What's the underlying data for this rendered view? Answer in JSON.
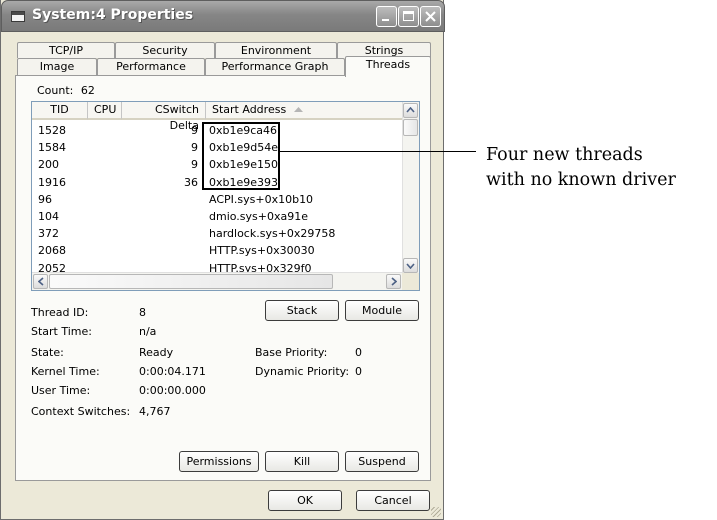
{
  "window": {
    "title": "System:4 Properties",
    "icon": "window-icon",
    "controls": [
      "minimize-icon",
      "maximize-icon",
      "close-icon"
    ]
  },
  "tabs": {
    "row1": [
      "TCP/IP",
      "Security",
      "Environment",
      "Strings"
    ],
    "row2": [
      "Image",
      "Performance",
      "Performance Graph",
      "Threads"
    ],
    "active": "Threads"
  },
  "threads": {
    "count_label": "Count:",
    "count_value": "62",
    "columns": [
      "TID",
      "CPU",
      "CSwitch Delta",
      "Start Address"
    ],
    "sort_icon": "sort-ascending-icon",
    "rows": [
      {
        "tid": "1528",
        "cpu": "",
        "cswitch": "9",
        "address": "0xb1e9ca46"
      },
      {
        "tid": "1584",
        "cpu": "",
        "cswitch": "9",
        "address": "0xb1e9d54e"
      },
      {
        "tid": "200",
        "cpu": "",
        "cswitch": "9",
        "address": "0xb1e9e150"
      },
      {
        "tid": "1916",
        "cpu": "",
        "cswitch": "36",
        "address": "0xb1e9e393"
      },
      {
        "tid": "96",
        "cpu": "",
        "cswitch": "",
        "address": "ACPI.sys+0x10b10"
      },
      {
        "tid": "104",
        "cpu": "",
        "cswitch": "",
        "address": "dmio.sys+0xa91e"
      },
      {
        "tid": "372",
        "cpu": "",
        "cswitch": "",
        "address": "hardlock.sys+0x29758"
      },
      {
        "tid": "2068",
        "cpu": "",
        "cswitch": "",
        "address": "HTTP.sys+0x30030"
      },
      {
        "tid": "2052",
        "cpu": "",
        "cswitch": "",
        "address": "HTTP.sys+0x329f0"
      }
    ]
  },
  "details": {
    "thread_id_label": "Thread ID:",
    "thread_id": "8",
    "start_time_label": "Start Time:",
    "start_time": "n/a",
    "state_label": "State:",
    "state": "Ready",
    "kernel_time_label": "Kernel Time:",
    "kernel_time": "0:00:04.171",
    "user_time_label": "User Time:",
    "user_time": "0:00:00.000",
    "context_switches_label": "Context Switches:",
    "context_switches": "4,767",
    "base_priority_label": "Base Priority:",
    "base_priority": "0",
    "dynamic_priority_label": "Dynamic Priority:",
    "dynamic_priority": "0"
  },
  "buttons": {
    "stack": "Stack",
    "module": "Module",
    "permissions": "Permissions",
    "kill": "Kill",
    "suspend": "Suspend",
    "ok": "OK",
    "cancel": "Cancel"
  },
  "annotation": {
    "line1": "Four new threads",
    "line2": "with no known driver"
  }
}
